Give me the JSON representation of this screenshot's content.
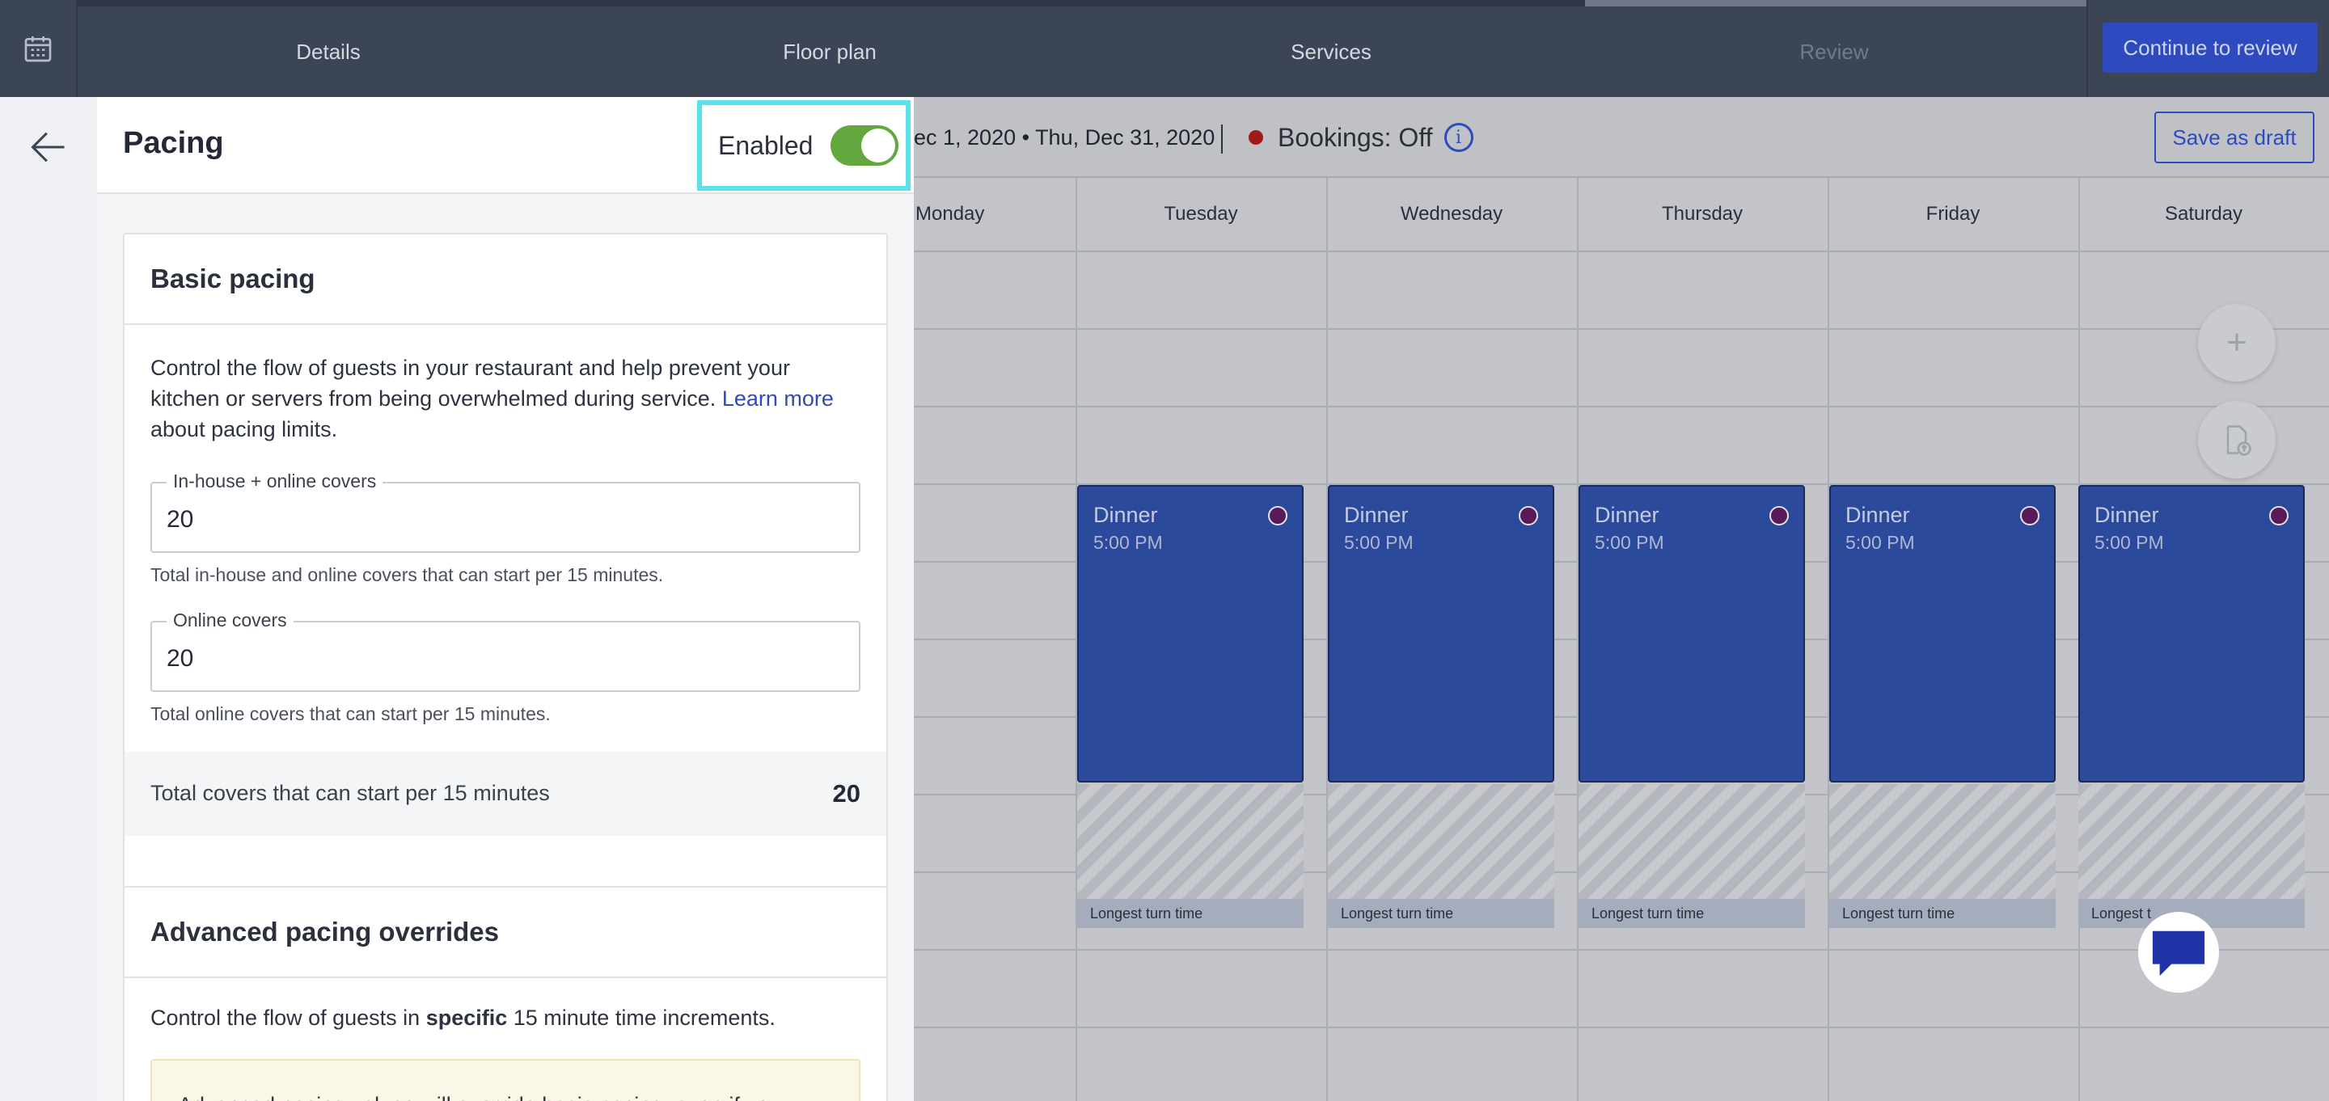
{
  "topbar": {
    "tabs": [
      {
        "label": "Details"
      },
      {
        "label": "Floor plan"
      },
      {
        "label": "Services"
      },
      {
        "label": "Review"
      }
    ],
    "continue_label": "Continue to review"
  },
  "calendar": {
    "date_range": "ec 1, 2020 • Thu, Dec 31, 2020",
    "bookings_label": "Bookings:",
    "bookings_value": "Off",
    "save_draft_label": "Save as draft",
    "days": [
      "Monday",
      "Tuesday",
      "Wednesday",
      "Thursday",
      "Friday",
      "Saturday"
    ],
    "service_name": "Dinner",
    "service_time": "5:00 PM",
    "turn_label": "Longest turn time",
    "turn_label_short": "Longest t",
    "colors": {
      "service": "#2c4a9c",
      "bookings_off": "#a11a1a"
    }
  },
  "panel": {
    "title": "Pacing",
    "enabled_label": "Enabled",
    "enabled": true,
    "basic": {
      "title": "Basic pacing",
      "desc_part1": "Control the flow of guests in your restaurant and help prevent your kitchen or servers from being overwhelmed during service. ",
      "learn_more": "Learn more",
      "desc_part2": " about pacing limits.",
      "field1_label": "In-house + online covers",
      "field1_value": "20",
      "field1_helper": "Total in-house and online covers that can start per 15 minutes.",
      "field2_label": "Online covers",
      "field2_value": "20",
      "field2_helper": "Total online covers that can start per 15 minutes.",
      "total_label": "Total covers that can start per 15 minutes",
      "total_value": "20"
    },
    "advanced": {
      "title": "Advanced pacing overrides",
      "desc_pre": "Control the flow of guests in ",
      "desc_bold": "specific",
      "desc_post": " 15 minute time increments.",
      "warning": "Advanced pacing values will override basic pacing, even if you"
    }
  }
}
